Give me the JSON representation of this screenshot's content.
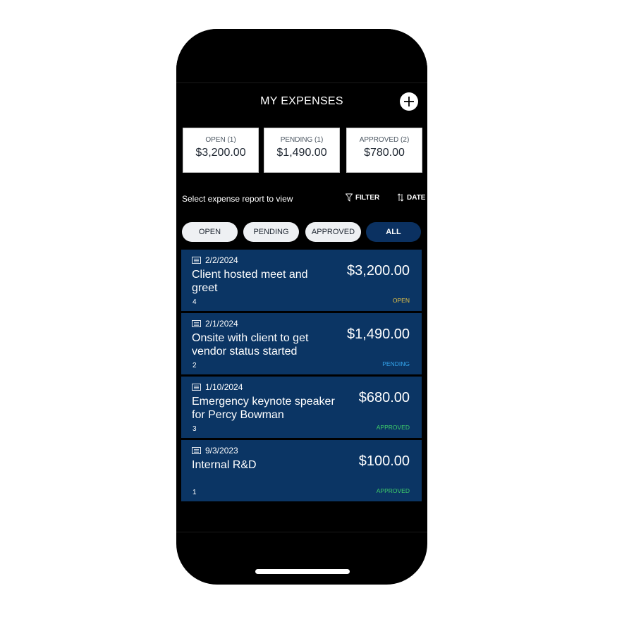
{
  "header": {
    "title": "MY EXPENSES",
    "add_icon": "plus-circle-icon"
  },
  "summary": [
    {
      "label": "OPEN (1)",
      "amount": "$3,200.00"
    },
    {
      "label": "PENDING (1)",
      "amount": "$1,490.00"
    },
    {
      "label": "APPROVED (2)",
      "amount": "$780.00"
    }
  ],
  "toolbar": {
    "instruction": "Select expense report to view",
    "filter_label": "FILTER",
    "filter_icon": "funnel-icon",
    "sort_label": "DATE",
    "sort_icon": "sort-arrows-icon"
  },
  "tabs": [
    {
      "label": "OPEN",
      "active": false
    },
    {
      "label": "PENDING",
      "active": false
    },
    {
      "label": "APPROVED",
      "active": false
    },
    {
      "label": "ALL",
      "active": true
    }
  ],
  "reports": [
    {
      "date": "2/2/2024",
      "title": "Client hosted meet and greet",
      "count": "4",
      "amount": "$3,200.00",
      "status": "OPEN"
    },
    {
      "date": "2/1/2024",
      "title": "Onsite with client to get vendor status started",
      "count": "2",
      "amount": "$1,490.00",
      "status": "PENDING"
    },
    {
      "date": "1/10/2024",
      "title": "Emergency keynote speaker for Percy Bowman",
      "count": "3",
      "amount": "$680.00",
      "status": "APPROVED"
    },
    {
      "date": "9/3/2023",
      "title": "Internal R&D",
      "count": "1",
      "amount": "$100.00",
      "status": "APPROVED"
    }
  ],
  "colors": {
    "background": "#000000",
    "card": "#0b3564",
    "active_tab": "#0b3161",
    "status_open": "#e8c547",
    "status_pending": "#35a7f0",
    "status_approved": "#3fcf6a"
  }
}
